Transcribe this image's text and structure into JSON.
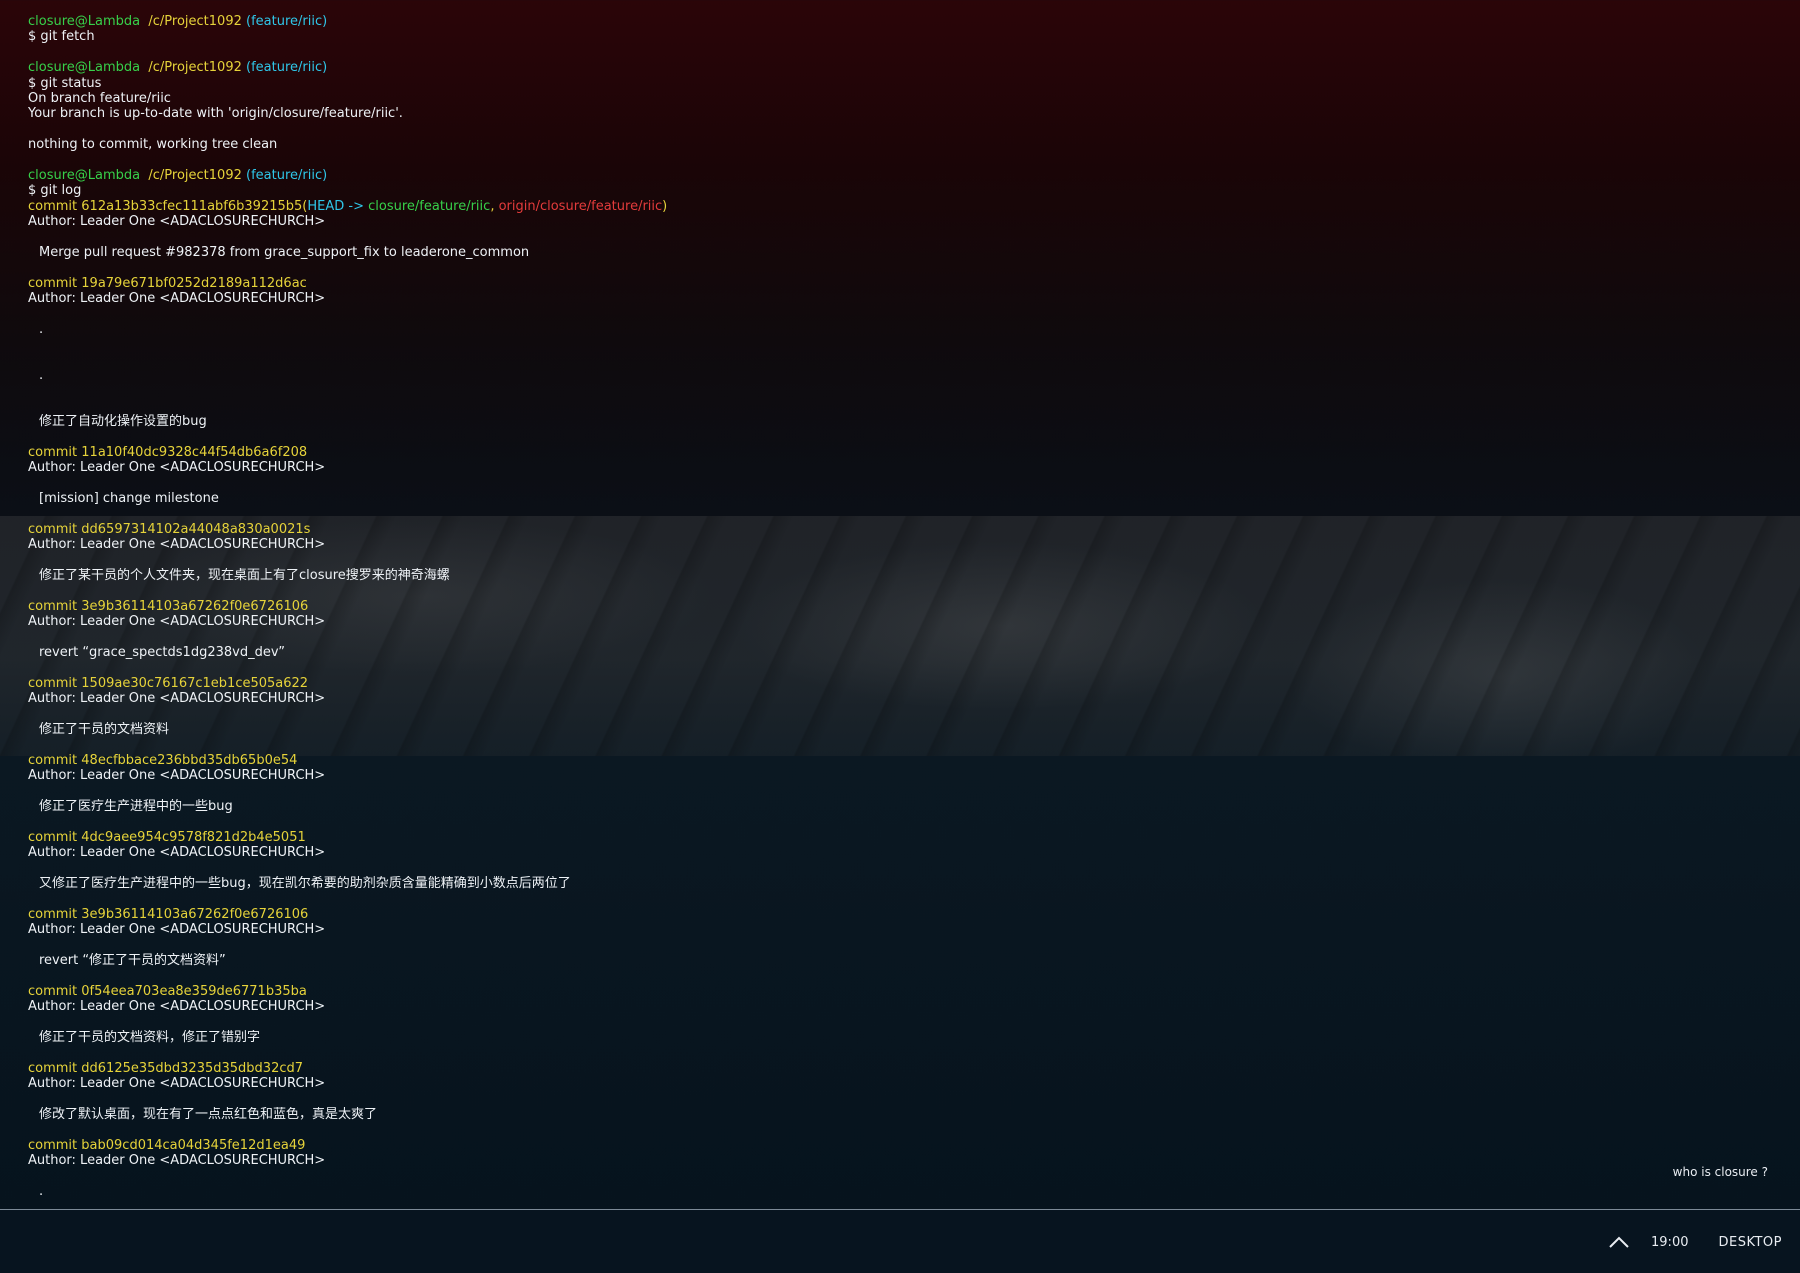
{
  "prompt": {
    "user": "closure@Lambda",
    "path": "/c/Project1092",
    "branch": "(feature/riic)",
    "dollar": "$ "
  },
  "cmd_fetch": "git fetch",
  "cmd_status": "git status",
  "status_lines": [
    "On branch feature/riic",
    "Your branch is up-to-date with 'origin/closure/feature/riic'.",
    "nothing to commit, working tree clean"
  ],
  "cmd_log": "git log",
  "author": "Author: Leader One <ADACLOSURECHURCH>",
  "commit_prefix": "commit ",
  "head_ref": {
    "open": "(",
    "head": "HEAD -> ",
    "local": "closure/feature/riic",
    "sep": ", ",
    "origin": "origin/closure/feature/riic",
    "close": ")"
  },
  "commits": [
    {
      "hash": "612a13b33cfec111abf6b39215b5",
      "messages": [
        "Merge pull request #982378 from grace_support_fix to leaderone_common"
      ]
    },
    {
      "hash": "19a79e671bf0252d2189a112d6ac",
      "messages": [
        ".",
        ".",
        "修正了自动化操作设置的bug"
      ]
    },
    {
      "hash": "11a10f40dc9328c44f54db6a6f208",
      "messages": [
        "[mission] change milestone"
      ]
    },
    {
      "hash": "dd6597314102a44048a830a0021s",
      "messages": [
        "修正了某干员的个人文件夹，现在桌面上有了closure搜罗来的神奇海螺"
      ]
    },
    {
      "hash": "3e9b36114103a67262f0e6726106",
      "messages": [
        "revert “grace_spectds1dg238vd_dev”"
      ]
    },
    {
      "hash": "1509ae30c76167c1eb1ce505a622",
      "messages": [
        "修正了干员的文档资料"
      ]
    },
    {
      "hash": "48ecfbbace236bbd35db65b0e54",
      "messages": [
        "修正了医疗生产进程中的一些bug"
      ]
    },
    {
      "hash": "4dc9aee954c9578f821d2b4e5051",
      "messages": [
        "又修正了医疗生产进程中的一些bug，现在凯尔希要的助剂杂质含量能精确到小数点后两位了"
      ]
    },
    {
      "hash": "3e9b36114103a67262f0e6726106",
      "messages": [
        "revert “修正了干员的文档资料”"
      ]
    },
    {
      "hash": "0f54eea703ea8e359de6771b35ba",
      "messages": [
        "修正了干员的文档资料，修正了错别字"
      ]
    },
    {
      "hash": "dd6125e35dbd3235d35dbd32cd7",
      "messages": [
        "修改了默认桌面，现在有了一点点红色和蓝色，真是太爽了"
      ]
    },
    {
      "hash": "bab09cd014ca04d345fe12d1ea49",
      "messages": [
        "."
      ]
    }
  ],
  "who_is": "who is closure ?",
  "taskbar": {
    "time": "19:00",
    "desktop": "DESKTOP",
    "chevron_icon": "chevron-up-icon"
  }
}
